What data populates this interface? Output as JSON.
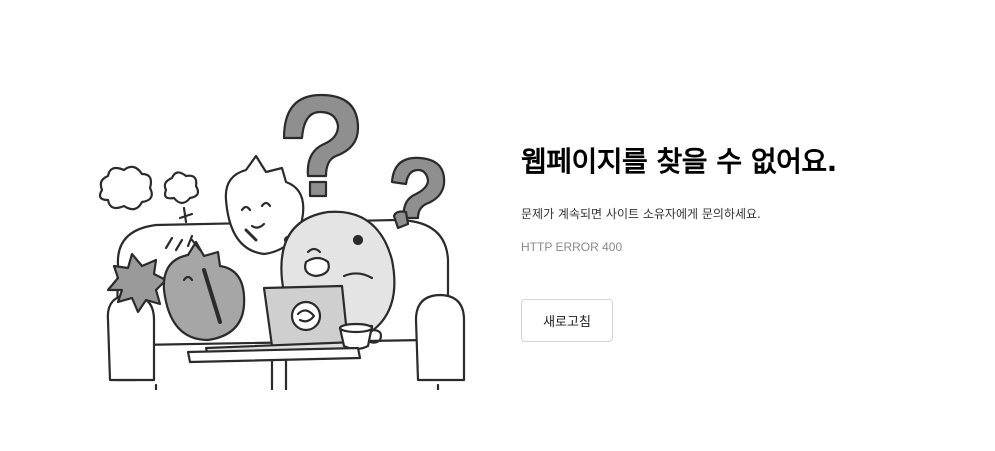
{
  "error_page": {
    "title": "웹페이지를 찾을 수 없어요.",
    "description": "문제가 계속되면 사이트 소유자에게 문의하세요.",
    "error_code": "HTTP ERROR 400",
    "reload_label": "새로고침"
  },
  "illustration": {
    "subject": "confused-characters-at-laptop-illustration",
    "palette": {
      "outline": "#2b2b2b",
      "dark_gray": "#9a9a9a",
      "mid_gray": "#bdbdbd",
      "light_gray": "#e6e6e6",
      "white": "#ffffff"
    }
  }
}
